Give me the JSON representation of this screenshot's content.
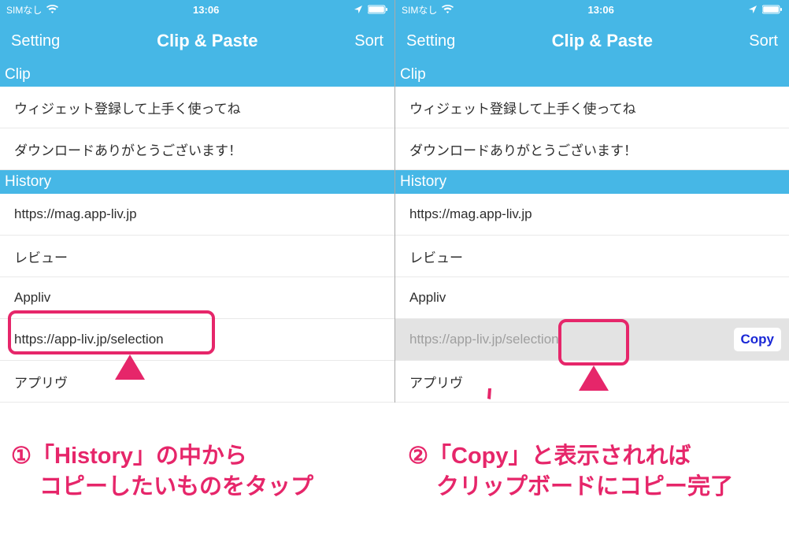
{
  "statusbar": {
    "carrier": "SIMなし",
    "time": "13:06"
  },
  "navbar": {
    "setting": "Setting",
    "title": "Clip & Paste",
    "sort": "Sort"
  },
  "sections": {
    "clip": "Clip",
    "history": "History",
    "clip_items": [
      "ウィジェット登録して上手く使ってね",
      "ダウンロードありがとうございます！"
    ],
    "history_items": [
      "https://mag.app-liv.jp",
      "レビュー",
      "Appliv",
      "https://app-liv.jp/selection",
      "アプリヴ"
    ]
  },
  "copy_label": "Copy",
  "captions": {
    "c1a": "①「History」の中から",
    "c1b": "コピーしたいものをタップ",
    "c2a": "②「Copy」と表示されれば",
    "c2b": "クリップボードにコピー完了"
  }
}
